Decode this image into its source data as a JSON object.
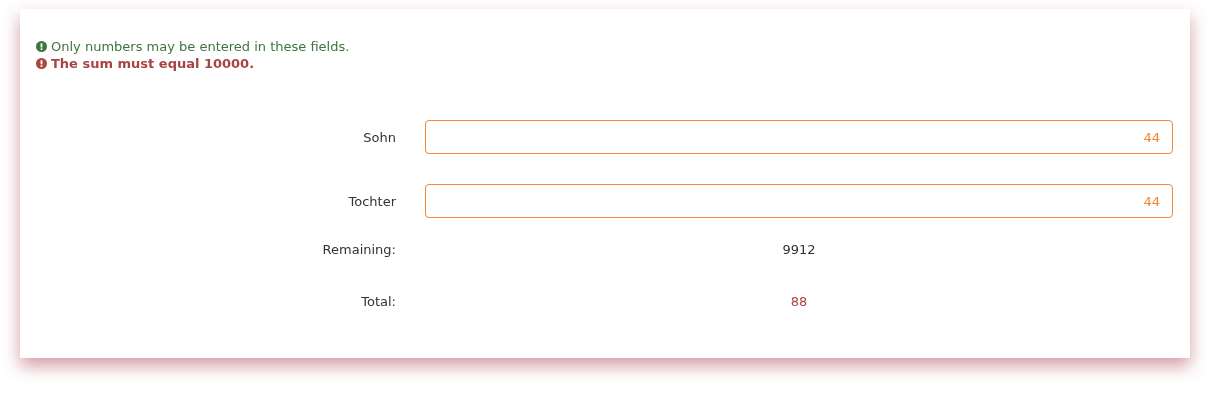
{
  "messages": [
    {
      "kind": "info",
      "text": "Only numbers may be entered in these fields."
    },
    {
      "kind": "error",
      "text": "The sum must equal 10000."
    }
  ],
  "fields": [
    {
      "label": "Sohn",
      "value": "44",
      "invalid": true
    },
    {
      "label": "Tochter",
      "value": "44",
      "invalid": true
    }
  ],
  "summary": [
    {
      "label": "Remaining:",
      "value": "9912",
      "invalid": false
    },
    {
      "label": "Total:",
      "value": "88",
      "invalid": true
    }
  ]
}
